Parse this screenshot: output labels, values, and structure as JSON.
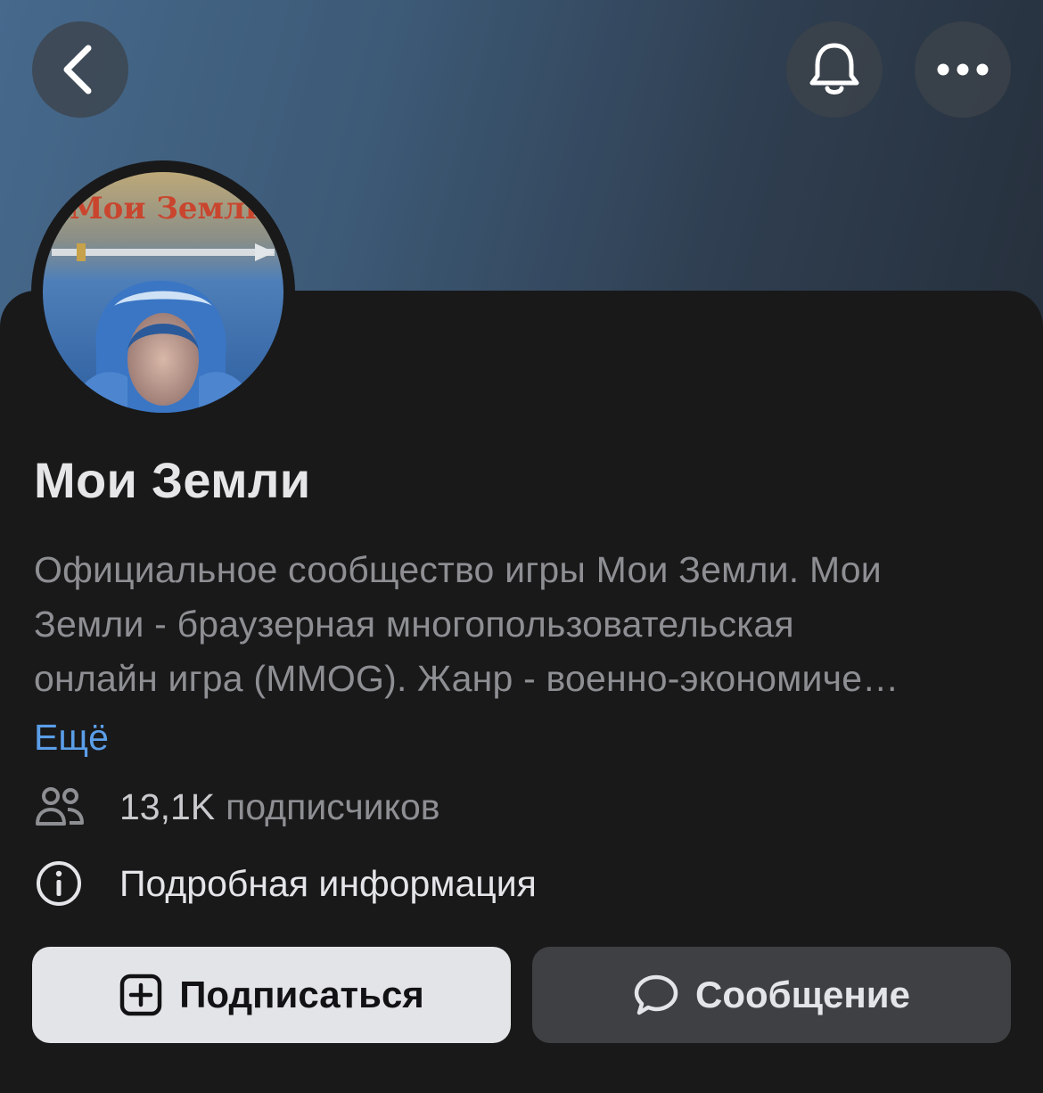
{
  "header": {
    "back_icon": "chevron-left-icon",
    "notify_icon": "bell-icon",
    "more_icon": "ellipsis-icon"
  },
  "community": {
    "avatar_text": "Мои Земли",
    "name": "Мои Земли",
    "description_lines": [
      "Официальное сообщество игры Мои Земли. Мои",
      "Земли - браузерная многопользовательская",
      "онлайн игра (MMOG). Жанр - военно-экономиче…"
    ],
    "more_label": "Ещё",
    "subscribers_count": "13,1K",
    "subscribers_label": "подписчиков",
    "details_label": "Подробная информация"
  },
  "actions": {
    "subscribe_label": "Подписаться",
    "message_label": "Сообщение"
  },
  "colors": {
    "accent_link": "#5b9ee8",
    "background": "#19191a"
  }
}
